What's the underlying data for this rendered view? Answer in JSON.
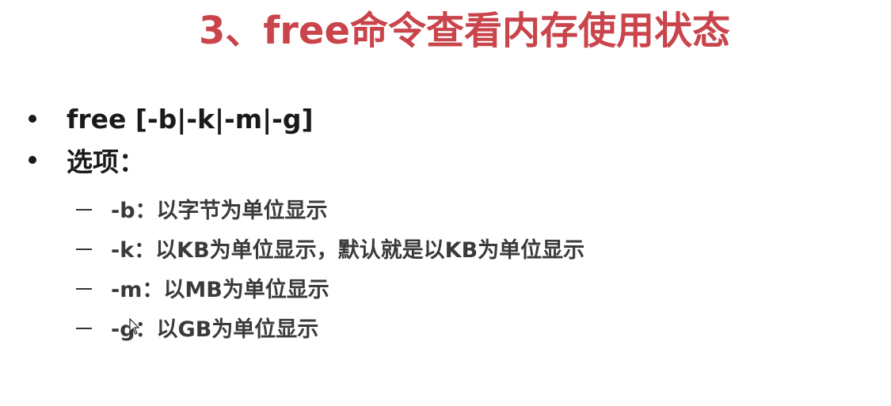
{
  "slide": {
    "title": "3、free命令查看内存使用状态",
    "bullets": [
      {
        "text": "free [-b|-k|-m|-g]"
      },
      {
        "text": "选项："
      }
    ],
    "options": [
      {
        "text": "-b：以字节为单位显示"
      },
      {
        "text": "-k：以KB为单位显示，默认就是以KB为单位显示"
      },
      {
        "text": "-m：以MB为单位显示"
      },
      {
        "text": "-g：以GB为单位显示"
      }
    ]
  },
  "colors": {
    "title": "#c9444b",
    "body_text": "#1a1a1a",
    "sub_text": "#3a3a3a",
    "background": "#ffffff"
  }
}
